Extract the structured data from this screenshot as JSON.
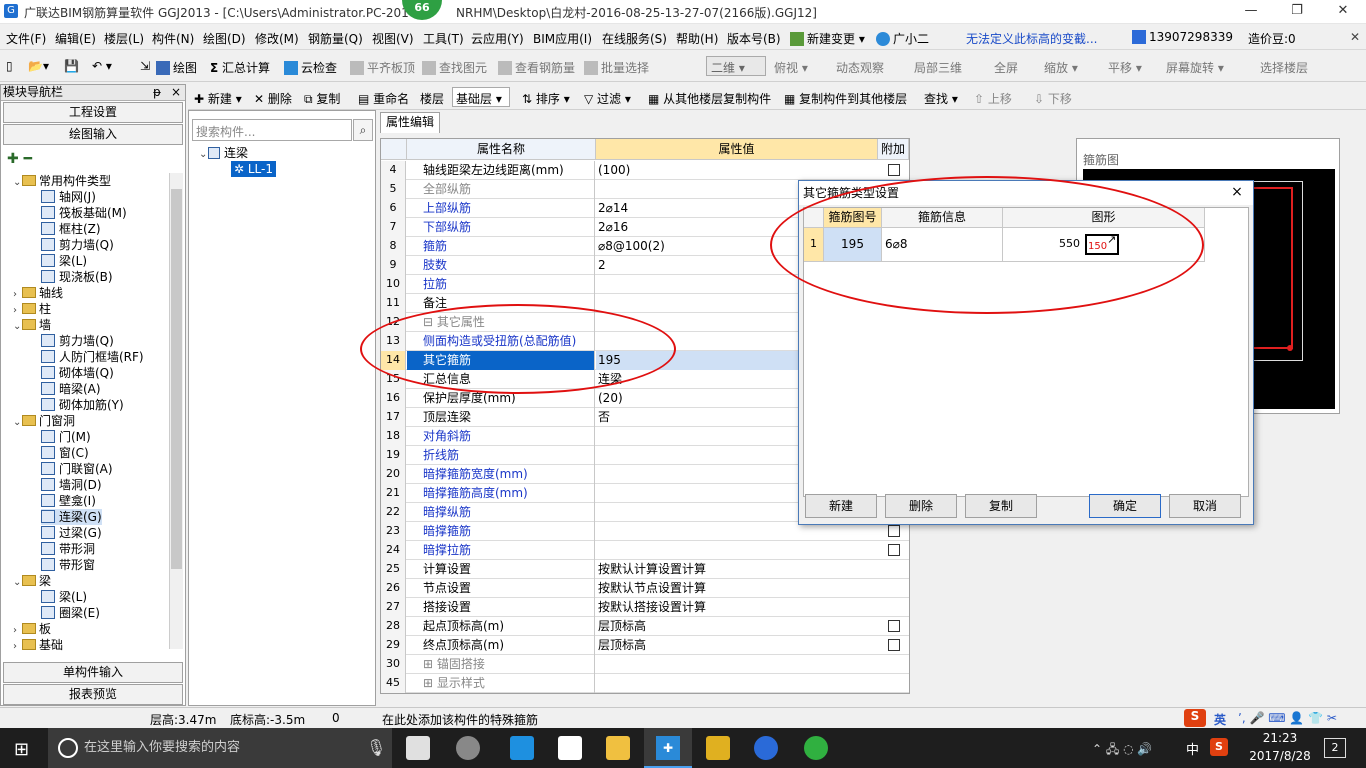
{
  "window": {
    "title": "广联达BIM钢筋算量软件 GGJ2013 - [C:\\Users\\Administrator.PC-201",
    "title_tail": "NRHM\\Desktop\\白龙村-2016-08-25-13-27-07(2166版).GGJ12]",
    "badge": "66"
  },
  "menu": [
    "文件(F)",
    "编辑(E)",
    "楼层(L)",
    "构件(N)",
    "绘图(D)",
    "修改(M)",
    "钢筋量(Q)",
    "视图(V)",
    "工具(T)",
    "云应用(Y)",
    "BIM应用(I)",
    "在线服务(S)",
    "帮助(H)",
    "版本号(B)",
    "新建变更",
    "广小二",
    "无法定义此标高的变截...",
    "13907298339",
    "造价豆:0"
  ],
  "toolbar1": {
    "draw": "绘图",
    "sum": "汇总计算",
    "cloud_check": "云检查",
    "flat_top": "平齐板顶",
    "find_elem": "查找图元",
    "view_qty": "查看钢筋量",
    "batch_select": "批量选择",
    "view_mode": "二维",
    "top_view": "俯视",
    "dynamic": "动态观察",
    "local3d": "局部三维",
    "fullscreen": "全屏",
    "zoom": "缩放",
    "pan": "平移",
    "rotate": "屏幕旋转",
    "select_floor": "选择楼层"
  },
  "toolbar2": {
    "new": "新建",
    "delete": "删除",
    "copy": "复制",
    "rename": "重命名",
    "floor_label": "楼层",
    "floor": "基础层",
    "sort": "排序",
    "filter": "过滤",
    "copy_from": "从其他楼层复制构件",
    "copy_to": "复制构件到其他楼层",
    "find": "查找",
    "up": "上移",
    "down": "下移"
  },
  "nav": {
    "header": "模块导航栏",
    "pin": "ᵽ",
    "close": "×",
    "btn_project": "工程设置",
    "btn_draw": "绘图输入",
    "btn_single": "单构件输入",
    "btn_report": "报表预览",
    "tree": [
      {
        "level": 0,
        "exp": "⌄",
        "folder": true,
        "label": "常用构件类型"
      },
      {
        "level": 1,
        "label": "轴网(J)"
      },
      {
        "level": 1,
        "label": "筏板基础(M)"
      },
      {
        "level": 1,
        "label": "框柱(Z)"
      },
      {
        "level": 1,
        "label": "剪力墙(Q)"
      },
      {
        "level": 1,
        "label": "梁(L)"
      },
      {
        "level": 1,
        "label": "现浇板(B)"
      },
      {
        "level": 0,
        "exp": "›",
        "folder": true,
        "label": "轴线"
      },
      {
        "level": 0,
        "exp": "›",
        "folder": true,
        "label": "柱"
      },
      {
        "level": 0,
        "exp": "⌄",
        "folder": true,
        "label": "墙"
      },
      {
        "level": 1,
        "label": "剪力墙(Q)"
      },
      {
        "level": 1,
        "label": "人防门框墙(RF)"
      },
      {
        "level": 1,
        "label": "砌体墙(Q)"
      },
      {
        "level": 1,
        "label": "暗梁(A)"
      },
      {
        "level": 1,
        "label": "砌体加筋(Y)"
      },
      {
        "level": 0,
        "exp": "⌄",
        "folder": true,
        "label": "门窗洞"
      },
      {
        "level": 1,
        "label": "门(M)"
      },
      {
        "level": 1,
        "label": "窗(C)"
      },
      {
        "level": 1,
        "label": "门联窗(A)"
      },
      {
        "level": 1,
        "label": "墙洞(D)"
      },
      {
        "level": 1,
        "label": "壁龛(I)"
      },
      {
        "level": 1,
        "label": "连梁(G)",
        "selected": true
      },
      {
        "level": 1,
        "label": "过梁(G)"
      },
      {
        "level": 1,
        "label": "带形洞"
      },
      {
        "level": 1,
        "label": "带形窗"
      },
      {
        "level": 0,
        "exp": "⌄",
        "folder": true,
        "label": "梁"
      },
      {
        "level": 1,
        "label": "梁(L)"
      },
      {
        "level": 1,
        "label": "圈梁(E)"
      },
      {
        "level": 0,
        "exp": "›",
        "folder": true,
        "label": "板"
      },
      {
        "level": 0,
        "exp": "›",
        "folder": true,
        "label": "基础"
      }
    ]
  },
  "components": {
    "search_placeholder": "搜索构件...",
    "root": "连梁",
    "child": "LL-1"
  },
  "props": {
    "tab": "属性编辑",
    "col_name": "属性名称",
    "col_value": "属性值",
    "col_extra": "附加",
    "rows": [
      {
        "n": "4",
        "name": "轴线距梁左边线距离(mm)",
        "val": "(100)",
        "style": "",
        "chk": true
      },
      {
        "n": "5",
        "name": "全部纵筋",
        "val": "",
        "style": "gray",
        "chk": false
      },
      {
        "n": "6",
        "name": "上部纵筋",
        "val": "2⌀14",
        "style": "blue",
        "chk": false
      },
      {
        "n": "7",
        "name": "下部纵筋",
        "val": "2⌀16",
        "style": "blue",
        "chk": false
      },
      {
        "n": "8",
        "name": "箍筋",
        "val": "⌀8@100(2)",
        "style": "blue",
        "chk": false
      },
      {
        "n": "9",
        "name": "肢数",
        "val": "2",
        "style": "blue",
        "chk": false
      },
      {
        "n": "10",
        "name": "拉筋",
        "val": "",
        "style": "blue",
        "chk": false
      },
      {
        "n": "11",
        "name": "备注",
        "val": "",
        "style": "",
        "chk": false
      },
      {
        "n": "12",
        "name": "⊟ 其它属性",
        "val": "",
        "style": "gray",
        "chk": false
      },
      {
        "n": "13",
        "name": "侧面构造或受扭筋(总配筋值)",
        "val": "",
        "style": "blue",
        "chk": false
      },
      {
        "n": "14",
        "name": "其它箍筋",
        "val": "195",
        "style": "selrow",
        "chk": false
      },
      {
        "n": "15",
        "name": "汇总信息",
        "val": "连梁",
        "style": "",
        "chk": false
      },
      {
        "n": "16",
        "name": "保护层厚度(mm)",
        "val": "(20)",
        "style": "",
        "chk": false
      },
      {
        "n": "17",
        "name": "顶层连梁",
        "val": "否",
        "style": "",
        "chk": false
      },
      {
        "n": "18",
        "name": "对角斜筋",
        "val": "",
        "style": "blue",
        "chk": false
      },
      {
        "n": "19",
        "name": "折线筋",
        "val": "",
        "style": "blue",
        "chk": false
      },
      {
        "n": "20",
        "name": "暗撑箍筋宽度(mm)",
        "val": "",
        "style": "blue",
        "chk": false
      },
      {
        "n": "21",
        "name": "暗撑箍筋高度(mm)",
        "val": "",
        "style": "blue",
        "chk": false
      },
      {
        "n": "22",
        "name": "暗撑纵筋",
        "val": "",
        "style": "blue",
        "chk": false
      },
      {
        "n": "23",
        "name": "暗撑箍筋",
        "val": "",
        "style": "blue",
        "chk": true
      },
      {
        "n": "24",
        "name": "暗撑拉筋",
        "val": "",
        "style": "blue",
        "chk": true
      },
      {
        "n": "25",
        "name": "计算设置",
        "val": "按默认计算设置计算",
        "style": "",
        "chk": false
      },
      {
        "n": "26",
        "name": "节点设置",
        "val": "按默认节点设置计算",
        "style": "",
        "chk": false
      },
      {
        "n": "27",
        "name": "搭接设置",
        "val": "按默认搭接设置计算",
        "style": "",
        "chk": false
      },
      {
        "n": "28",
        "name": "起点顶标高(m)",
        "val": "层顶标高",
        "style": "",
        "chk": true
      },
      {
        "n": "29",
        "name": "终点顶标高(m)",
        "val": "层顶标高",
        "style": "",
        "chk": true
      },
      {
        "n": "30",
        "name": "⊞ 锚固搭接",
        "val": "",
        "style": "gray",
        "chk": false
      },
      {
        "n": "45",
        "name": "⊞ 显示样式",
        "val": "",
        "style": "gray",
        "chk": false
      }
    ]
  },
  "preview": {
    "label": "箍筋图"
  },
  "dialog": {
    "title": "其它箍筋类型设置",
    "close": "×",
    "col_code": "箍筋图号",
    "col_info": "箍筋信息",
    "col_shape": "图形",
    "row": {
      "idx": "1",
      "code": "195",
      "info": "6⌀8",
      "len": "550",
      "shape_num": "150"
    },
    "btn_new": "新建",
    "btn_delete": "删除",
    "btn_copy": "复制",
    "btn_ok": "确定",
    "btn_cancel": "取消"
  },
  "status": {
    "floor_h": "层高:3.47m",
    "base_h": "底标高:-3.5m",
    "zero": "0",
    "hint": "在此处添加该构件的特殊箍筋"
  },
  "taskbar": {
    "search": "在这里输入你要搜索的内容",
    "time": "21:23",
    "date": "2017/8/28",
    "ime": "中",
    "notif": "2",
    "tray_lang": "英"
  },
  "colors": {
    "accent": "#0078d7",
    "selected_row": "#0a64c8",
    "ellipse": "#e01010",
    "header_bg": "#ffe7a8"
  }
}
